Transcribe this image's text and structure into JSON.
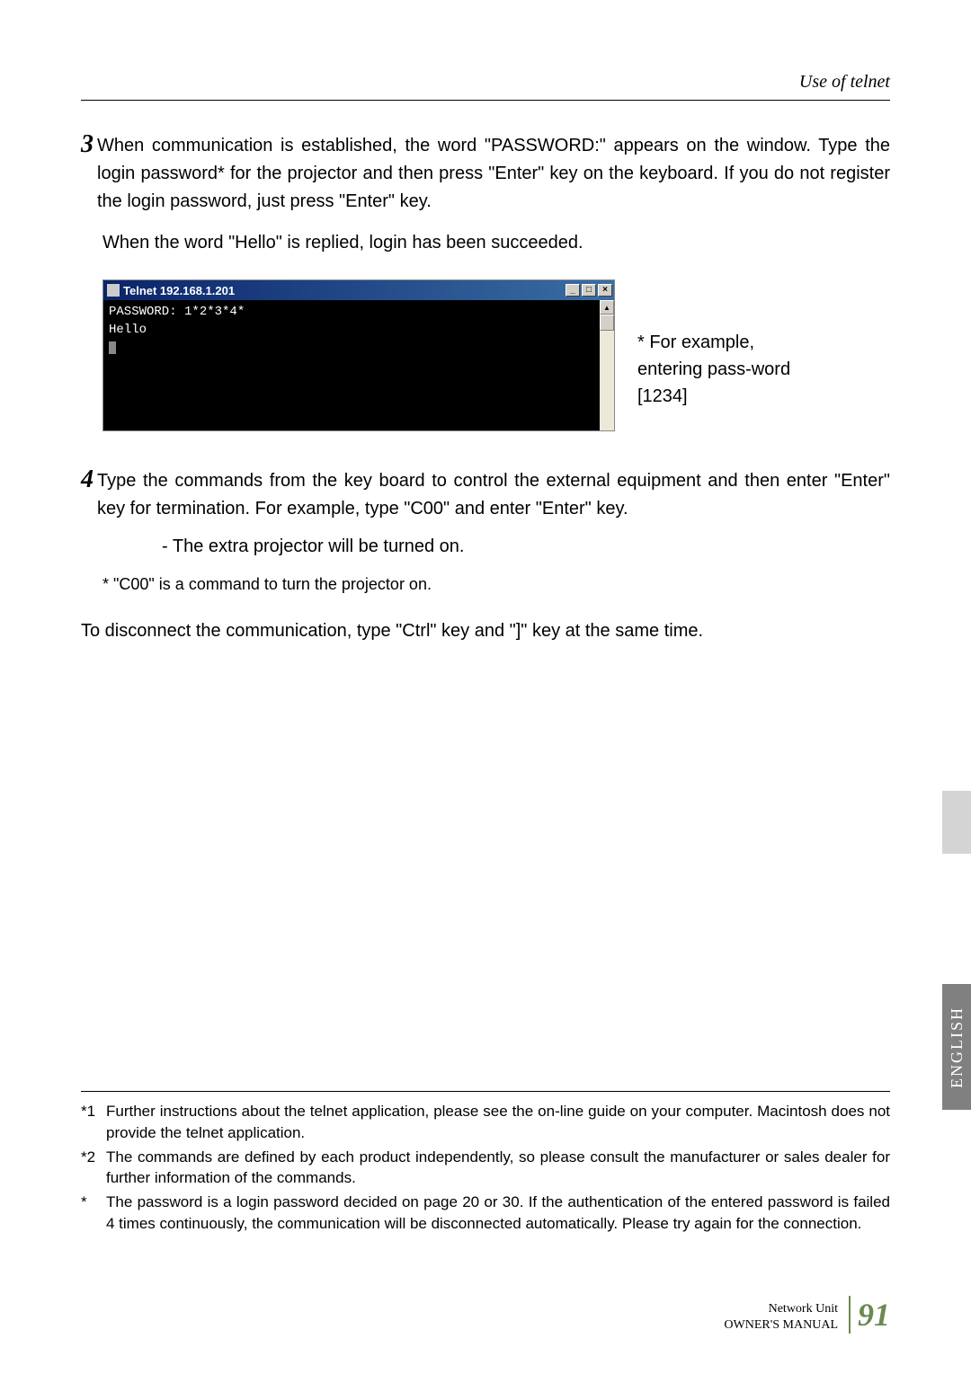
{
  "header": {
    "section_title": "Use of telnet"
  },
  "step3": {
    "number": "3",
    "text": "When communication is established, the word \"PASSWORD:\" appears on the window. Type the login password* for the projector and then press \"Enter\" key on the keyboard. If you do not register the login password, just press \"Enter\" key.",
    "text2": "When the word \"Hello\" is replied, login has been succeeded."
  },
  "telnet": {
    "title": "Telnet 192.168.1.201",
    "min": "_",
    "max": "□",
    "close": "×",
    "line1": "PASSWORD: 1*2*3*4*",
    "line2": "Hello",
    "scroll_up": "▲",
    "note": "* For example, entering pass-word [1234]"
  },
  "step4": {
    "number": "4",
    "text": "Type the commands from the key board to control the external equipment and then enter \"Enter\" key for termination. For example, type \"C00\" and enter \"Enter\" key.",
    "subpoint": "- The extra projector will be turned on.",
    "small_note": "* \"C00\" is a command to turn the projector on."
  },
  "disconnect": "To disconnect the communication, type \"Ctrl\" key and \"]\" key at the same time.",
  "footnotes": {
    "f1_mark": "*1",
    "f1_text": "Further instructions about the telnet application, please see the on-line guide on your computer. Macintosh does not provide the telnet application.",
    "f2_mark": "*2",
    "f2_text": "The commands are defined by each product independently, so please consult the manufacturer or sales dealer for further information of the commands.",
    "f3_mark": "*",
    "f3_text": "The password is a login password decided on page 20 or 30. If the authentication of the entered password is failed 4 times continuously, the communication will be disconnected automatically. Please try again for the connection."
  },
  "sidebar": {
    "label": "ENGLISH"
  },
  "footer": {
    "label1": "Network Unit",
    "label2": "OWNER'S MANUAL",
    "page": "91"
  }
}
